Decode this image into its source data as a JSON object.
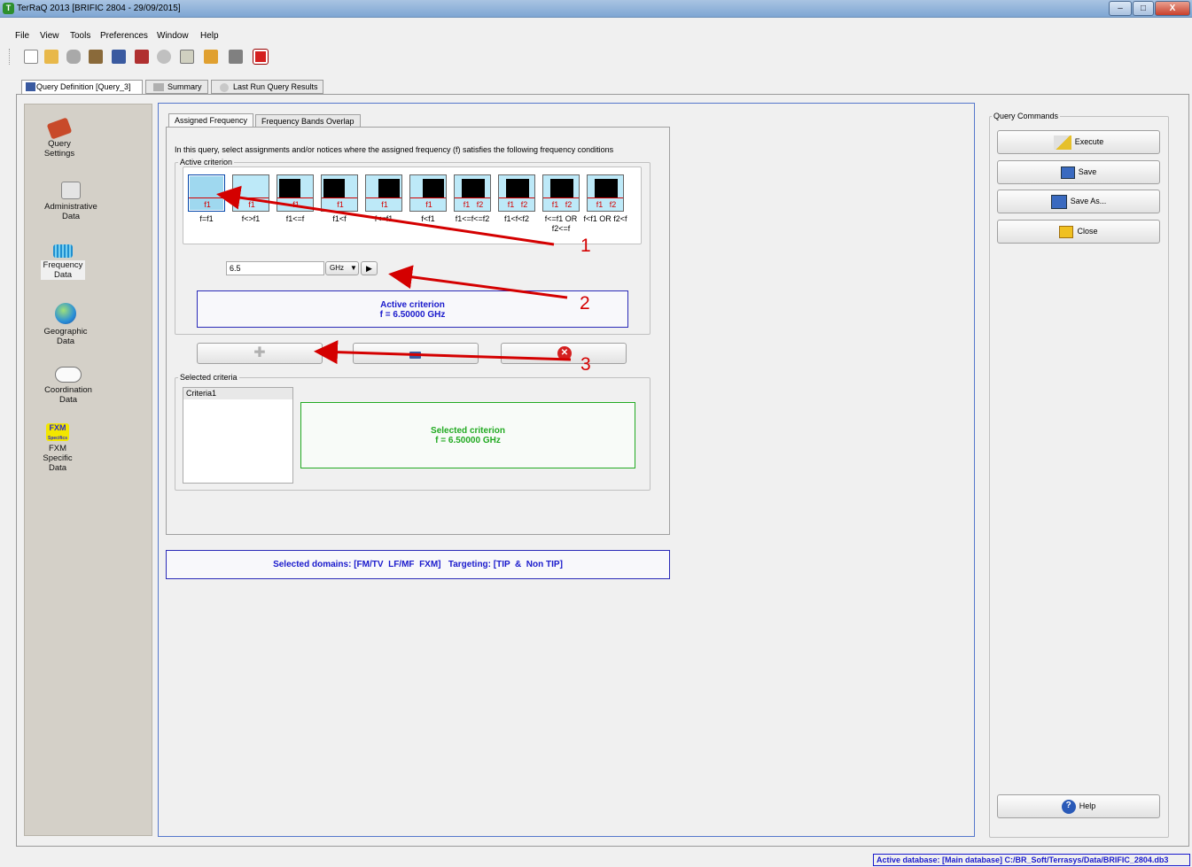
{
  "window": {
    "title": "TerRaQ 2013 [BRIFIC 2804 - 29/09/2015]",
    "minimize": "–",
    "maximize": "□",
    "close": "X"
  },
  "menu": [
    "File",
    "View",
    "Tools",
    "Preferences",
    "Window",
    "Help"
  ],
  "top_tabs": [
    "Query Definition [Query_3]",
    "Summary",
    "Last Run Query Results"
  ],
  "left_nav": [
    {
      "label": "Query Settings",
      "icon": "tools-icon"
    },
    {
      "label": "Administrative Data",
      "icon": "calendar-icon"
    },
    {
      "label": "Frequency Data",
      "icon": "frequency-icon"
    },
    {
      "label": "Geographic Data",
      "icon": "globe-icon"
    },
    {
      "label": "Coordination Data",
      "icon": "handshake-icon"
    },
    {
      "label": "FXM Specific Data",
      "icon": "fxm-icon"
    }
  ],
  "fxm_icon_text": "FXM",
  "fxm_icon_sub": "Specifics",
  "inner_tabs": [
    "Assigned Frequency",
    "Frequency Bands Overlap"
  ],
  "instruction": "In this query, select assignments and/or notices where the assigned frequency (f) satisfies the following frequency conditions",
  "active_criterion_group": "Active criterion",
  "criteria_buttons": [
    {
      "label": "f=f1",
      "marks": "f1"
    },
    {
      "label": "f<>f1",
      "marks": "f1"
    },
    {
      "label": "f1<=f",
      "marks": "f1"
    },
    {
      "label": "f1<f",
      "marks": "f1"
    },
    {
      "label": "f<=f1",
      "marks": "f1"
    },
    {
      "label": "f<f1",
      "marks": "f1"
    },
    {
      "label": "f1<=f<=f2",
      "marks": "f1   f2"
    },
    {
      "label": "f1<f<f2",
      "marks": "f1   f2"
    },
    {
      "label": "f<=f1 OR f2<=f",
      "marks": "f1   f2"
    },
    {
      "label": "f<f1 OR f2<f",
      "marks": "f1   f2"
    }
  ],
  "frequency_input": "6.5",
  "unit_select": "GHz",
  "active_box": {
    "title": "Active criterion",
    "value": "f = 6.50000 GHz"
  },
  "selected_criteria_group": "Selected criteria",
  "criteria_list": [
    "Criteria1"
  ],
  "selected_box": {
    "title": "Selected criterion",
    "value": "f = 6.50000 GHz"
  },
  "domains_text": "Selected domains: [FM/TV  LF/MF  FXM]   Targeting: [TIP  &  Non TIP]",
  "query_commands": {
    "title": "Query Commands",
    "execute": "Execute",
    "save": "Save",
    "save_as": "Save As...",
    "close": "Close",
    "help": "Help"
  },
  "annotations": [
    "1",
    "2",
    "3"
  ],
  "status_bar": "Active database: [Main database] C:/BR_Soft/Terrasys/Data/BRIFIC_2804.db3",
  "colors": {
    "annotation": "#d40000",
    "active_text": "#1a1acc",
    "selected_text": "#22aa22",
    "title_bar": "#7ea6d3"
  }
}
